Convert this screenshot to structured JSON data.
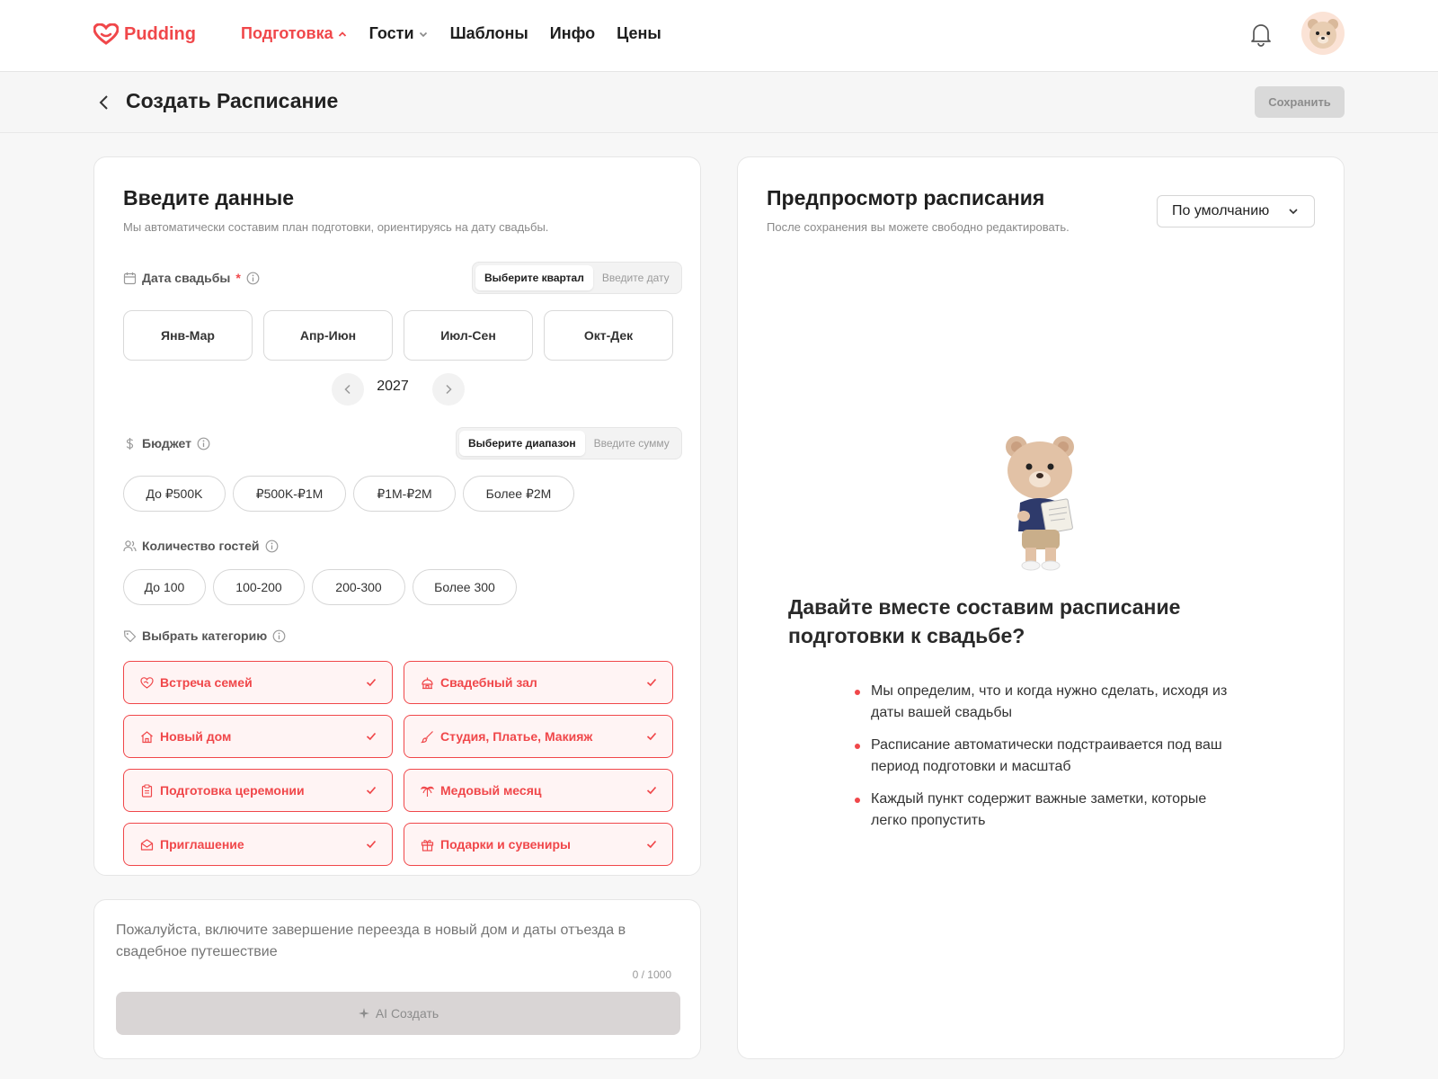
{
  "nav": {
    "brand": "Pudding",
    "items": [
      {
        "label": "Подготовка",
        "active": true,
        "chevron": "chevron-up-icon"
      },
      {
        "label": "Гости",
        "active": false,
        "chevron": "chevron-down-icon"
      },
      {
        "label": "Шаблоны",
        "active": false
      },
      {
        "label": "Инфо",
        "active": false
      },
      {
        "label": "Цены",
        "active": false
      }
    ]
  },
  "subheader": {
    "title": "Создать Расписание",
    "save_label": "Сохранить"
  },
  "form": {
    "title": "Введите данные",
    "subtitle": "Мы автоматически составим план подготовки, ориентируясь на дату свадьбы.",
    "date": {
      "label": "Дата свадьбы",
      "required_mark": "*",
      "mode_options": [
        "Выберите квартал",
        "Введите дату"
      ],
      "mode_selected": 0,
      "quarters": [
        "Янв-Мар",
        "Апр-Июн",
        "Июл-Сен",
        "Окт-Дек"
      ],
      "year": "2027"
    },
    "budget": {
      "label": "Бюджет",
      "mode_options": [
        "Выберите диапазон",
        "Введите сумму"
      ],
      "mode_selected": 0,
      "ranges": [
        "До ₽500K",
        "₽500K-₽1M",
        "₽1M-₽2M",
        "Более ₽2M"
      ]
    },
    "guests": {
      "label": "Количество гостей",
      "ranges": [
        "До 100",
        "100-200",
        "200-300",
        "Более 300"
      ]
    },
    "categories": {
      "label": "Выбрать категорию",
      "items": [
        {
          "label": "Встреча семей",
          "icon": "heart-handshake-icon",
          "checked": true
        },
        {
          "label": "Свадебный зал",
          "icon": "venue-icon",
          "checked": true
        },
        {
          "label": "Новый дом",
          "icon": "home-icon",
          "checked": true
        },
        {
          "label": "Студия, Платье, Макияж",
          "icon": "brush-icon",
          "checked": true
        },
        {
          "label": "Подготовка церемонии",
          "icon": "clipboard-icon",
          "checked": true
        },
        {
          "label": "Медовый месяц",
          "icon": "palm-icon",
          "checked": true
        },
        {
          "label": "Приглашение",
          "icon": "envelope-icon",
          "checked": true
        },
        {
          "label": "Подарки и сувениры",
          "icon": "gift-icon",
          "checked": true
        }
      ]
    }
  },
  "prompt": {
    "placeholder": "Пожалуйста, включите завершение переезда в новый дом и даты отъезда в свадебное путешествие",
    "counter": "0 / 1000",
    "button": "AI Создать"
  },
  "preview": {
    "title": "Предпросмотр расписания",
    "subtitle": "После сохранения вы можете свободно редактировать.",
    "dropdown": "По умолчанию",
    "headline": "Давайте вместе составим расписание подготовки к свадьбе?",
    "bullets": [
      "Мы определим, что и когда нужно сделать, исходя из даты вашей свадьбы",
      "Расписание автоматически подстраивается под ваш период подготовки и масштаб",
      "Каждый пункт содержит важные заметки, которые легко пропустить"
    ]
  },
  "colors": {
    "accent": "#f0474a",
    "accent_bg": "#fff4f4",
    "disabled_bg": "#d9d9d9"
  }
}
